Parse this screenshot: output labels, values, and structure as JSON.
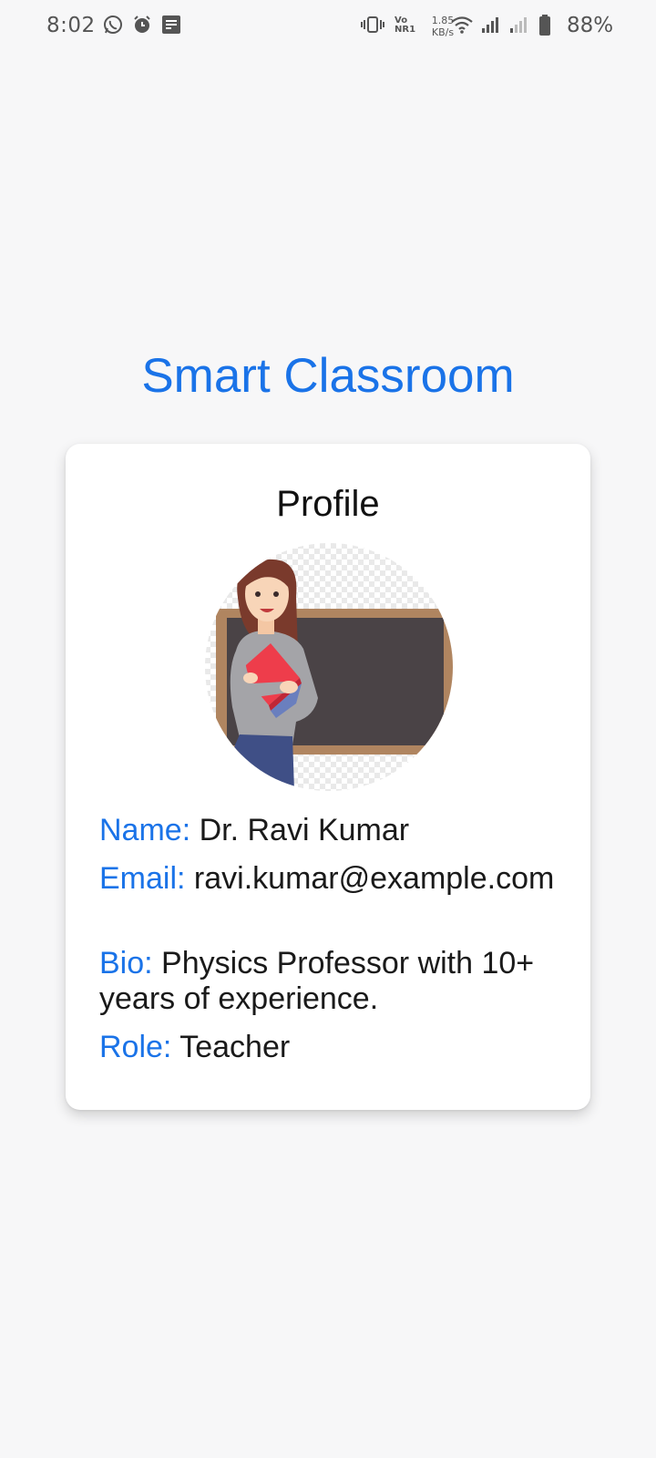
{
  "status_bar": {
    "time": "8:02",
    "volte": "Vo NR1",
    "net_speed_value": "1.85",
    "net_speed_unit": "KB/s",
    "battery_pct": "88%"
  },
  "app": {
    "title": "Smart Classroom"
  },
  "profile": {
    "heading": "Profile",
    "avatar_icon": "teacher-illustration",
    "name_label": "Name:",
    "name_value": "Dr. Ravi Kumar",
    "email_label": "Email:",
    "email_value": "ravi.kumar@example.com",
    "bio_label": "Bio:",
    "bio_value": "Physics Professor with 10+ years of experience.",
    "role_label": "Role:",
    "role_value": "Teacher"
  },
  "colors": {
    "accent": "#1a73e8",
    "background": "#f7f7f8",
    "card": "#ffffff"
  }
}
